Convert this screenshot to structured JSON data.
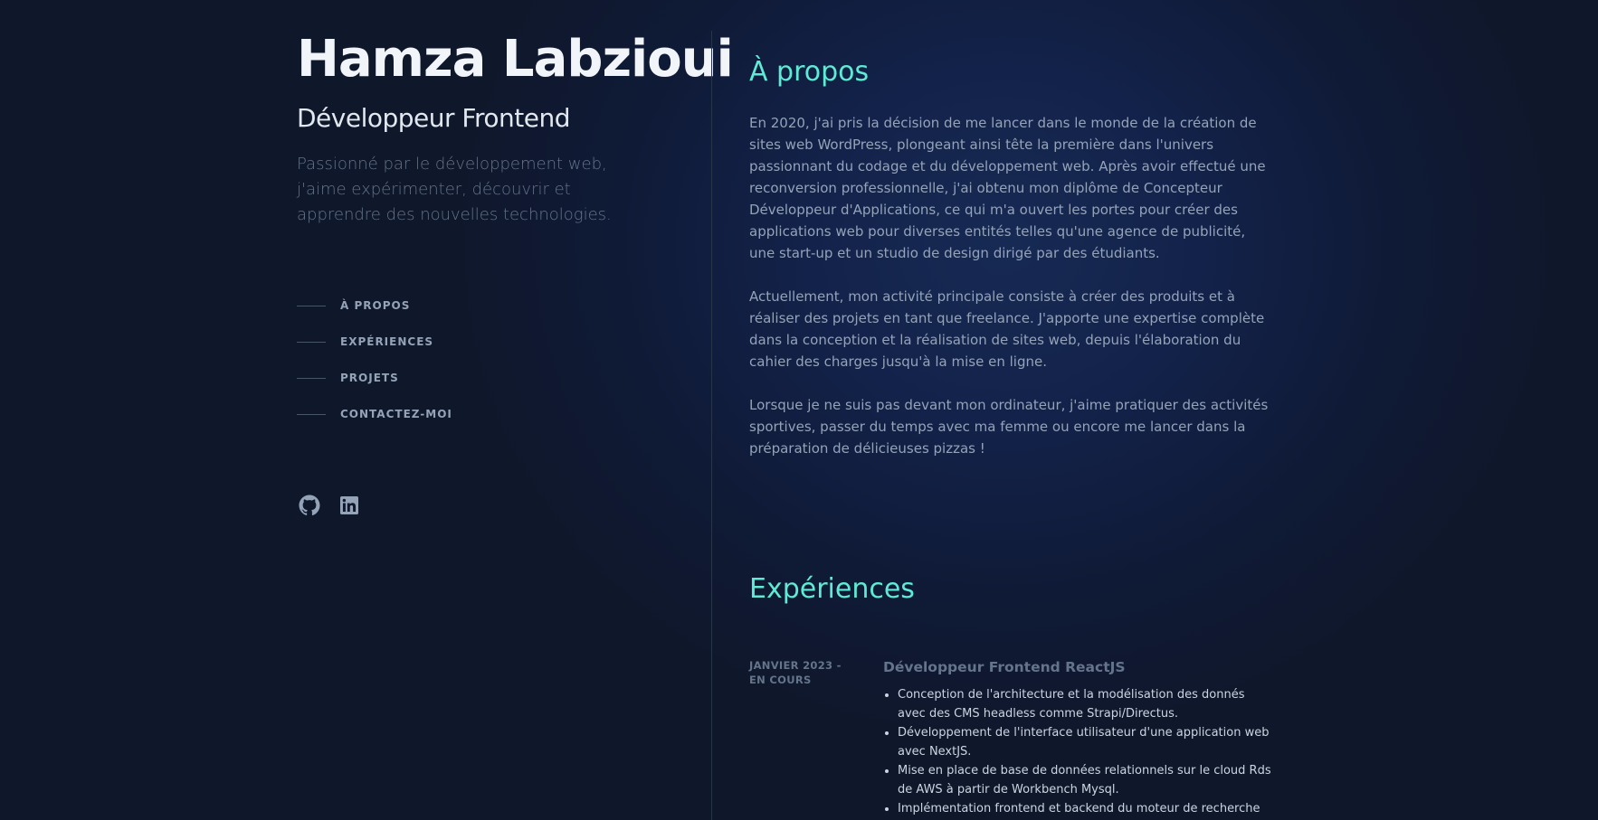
{
  "header": {
    "name": "Hamza Labzioui",
    "role": "Développeur Frontend",
    "tagline": "Passionné par le développement web, j'aime expérimenter, découvrir et apprendre des nouvelles technologies."
  },
  "nav": {
    "items": [
      {
        "label": "À PROPOS"
      },
      {
        "label": "EXPÉRIENCES"
      },
      {
        "label": "PROJETS"
      },
      {
        "label": "CONTACTEZ-MOI"
      }
    ]
  },
  "socials": [
    {
      "icon": "github-icon"
    },
    {
      "icon": "linkedin-icon"
    }
  ],
  "about": {
    "title": "À propos",
    "paragraphs": [
      "En 2020, j'ai pris la décision de me lancer dans le monde de la création de sites web WordPress, plongeant ainsi tête la première dans l'univers passionnant du codage et du développement web. Après avoir effectué une reconversion professionnelle, j'ai obtenu mon diplôme de Concepteur Développeur d'Applications, ce qui m'a ouvert les portes pour créer des applications web pour diverses entités telles qu'une agence de publicité, une start-up et un studio de design dirigé par des étudiants.",
      "Actuellement, mon activité principale consiste à créer des produits et à réaliser des projets en tant que freelance. J'apporte une expertise complète dans la conception et la réalisation de sites web, depuis l'élaboration du cahier des charges jusqu'à la mise en ligne.",
      "Lorsque je ne suis pas devant mon ordinateur, j'aime pratiquer des activités sportives, passer du temps avec ma femme ou encore me lancer dans la préparation de délicieuses pizzas !"
    ]
  },
  "experiences": {
    "title": "Expériences",
    "items": [
      {
        "date": "JANVIER 2023 - EN COURS",
        "role": "Développeur Frontend ReactJS",
        "bullets": [
          "Conception de l'architecture et la modélisation des donnés avec des CMS headless comme Strapi/Directus.",
          "Développement de l'interface utilisateur d'une application web avec NextJS.",
          "Mise en place de base de données relationnels sur le cloud Rds de AWS à partir de Workbench Mysql.",
          "Implémentation frontend et backend du moteur de recherche"
        ]
      }
    ]
  },
  "colors": {
    "accent": "#5eead4",
    "background": "#0f172a",
    "text_muted": "#94a3b8"
  }
}
